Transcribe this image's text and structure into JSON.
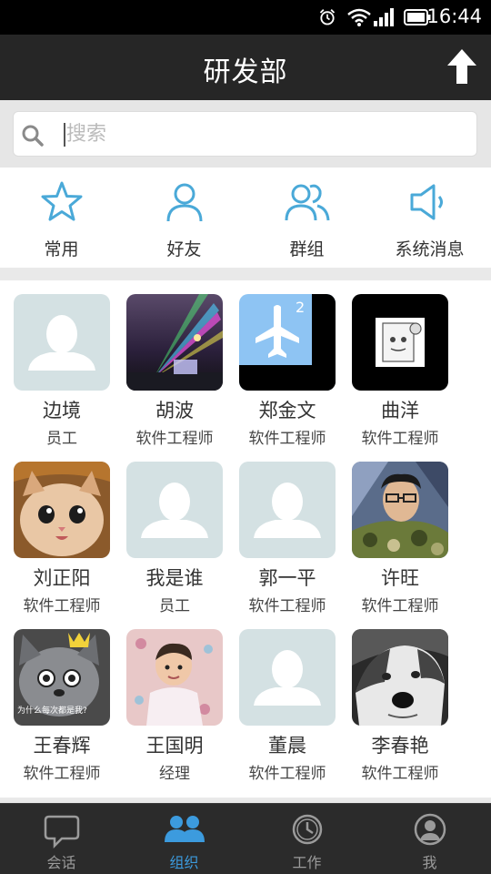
{
  "status_bar": {
    "time": "16:44"
  },
  "header": {
    "title": "研发部"
  },
  "search": {
    "placeholder": "搜索",
    "value": ""
  },
  "quick_actions": [
    {
      "label": "常用",
      "icon": "star-icon"
    },
    {
      "label": "好友",
      "icon": "person-icon"
    },
    {
      "label": "群组",
      "icon": "group-icon"
    },
    {
      "label": "系统消息",
      "icon": "speaker-icon"
    }
  ],
  "members": [
    {
      "name": "边境",
      "role": "员工",
      "avatar": "default-avatar"
    },
    {
      "name": "胡波",
      "role": "软件工程师",
      "avatar": "night-lights-photo"
    },
    {
      "name": "郑金文",
      "role": "软件工程师",
      "avatar": "airplane-avatar",
      "badge": "2"
    },
    {
      "name": "曲洋",
      "role": "软件工程师",
      "avatar": "paper-roll-meme"
    },
    {
      "name": "刘正阳",
      "role": "软件工程师",
      "avatar": "kitten-photo"
    },
    {
      "name": "我是谁",
      "role": "员工",
      "avatar": "default-avatar"
    },
    {
      "name": "郭一平",
      "role": "软件工程师",
      "avatar": "default-avatar"
    },
    {
      "name": "许旺",
      "role": "软件工程师",
      "avatar": "man-camouflage-photo"
    },
    {
      "name": "王春辉",
      "role": "软件工程师",
      "avatar": "cartoon-wolf",
      "caption": "为什么每次都是我?"
    },
    {
      "name": "王国明",
      "role": "经理",
      "avatar": "baby-photo"
    },
    {
      "name": "董晨",
      "role": "软件工程师",
      "avatar": "default-avatar"
    },
    {
      "name": "李春艳",
      "role": "软件工程师",
      "avatar": "husky-photo"
    }
  ],
  "tabs": [
    {
      "label": "会话",
      "icon": "chat-bubble-icon",
      "active": false
    },
    {
      "label": "组织",
      "icon": "organization-icon",
      "active": true
    },
    {
      "label": "工作",
      "icon": "clock-icon",
      "active": false
    },
    {
      "label": "我",
      "icon": "user-icon",
      "active": false
    }
  ],
  "colors": {
    "accent": "#3c9bde",
    "icon_blue": "#4aa9d8",
    "header_bg": "#262626",
    "tabbar_bg": "#2b2b2b",
    "placeholder_avatar": "#d4e1e3"
  }
}
